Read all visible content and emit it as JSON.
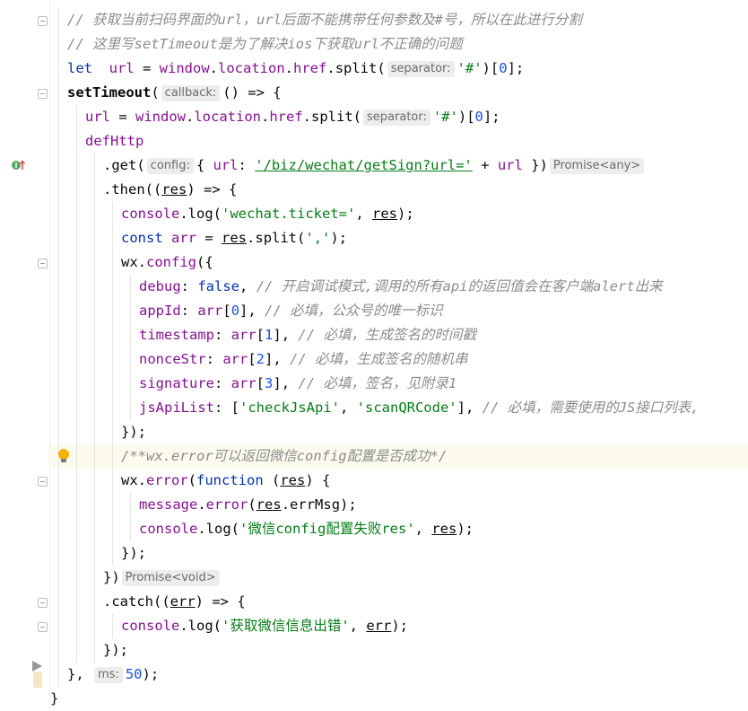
{
  "editor": {
    "lines": [
      {
        "segments": [
          [
            "cmt",
            "// 获取当前扫码界面的url，url后面不能携带任何参数及#号，所以在此进行分割"
          ]
        ]
      },
      {
        "segments": [
          [
            "cmt",
            "// 这里写setTimeout是为了解决ios下获取url不正确的问题"
          ]
        ]
      },
      {
        "segments": [
          [
            "kw",
            "let"
          ],
          [
            "",
            "  "
          ],
          [
            "prop",
            "url"
          ],
          [
            "",
            " = "
          ],
          [
            "prop",
            "window"
          ],
          [
            "",
            "."
          ],
          [
            "prop",
            "location"
          ],
          [
            "",
            "."
          ],
          [
            "prop",
            "href"
          ],
          [
            "",
            "."
          ],
          [
            "",
            "split("
          ],
          [
            "hint",
            "separator:"
          ],
          [
            "str",
            "'#'"
          ],
          [
            "",
            ")["
          ],
          [
            "num",
            "0"
          ],
          [
            "",
            "];"
          ]
        ]
      },
      {
        "segments": [
          [
            "bold",
            "setTimeout"
          ],
          [
            "",
            "("
          ],
          [
            "hint",
            "callback:"
          ],
          [
            "",
            "() => {"
          ]
        ]
      },
      {
        "segments": [
          [
            "prop",
            "url"
          ],
          [
            "",
            " = "
          ],
          [
            "prop",
            "window"
          ],
          [
            "",
            "."
          ],
          [
            "prop",
            "location"
          ],
          [
            "",
            "."
          ],
          [
            "prop",
            "href"
          ],
          [
            "",
            "."
          ],
          [
            "",
            "split("
          ],
          [
            "hint",
            "separator:"
          ],
          [
            "str",
            "'#'"
          ],
          [
            "",
            ")["
          ],
          [
            "num",
            "0"
          ],
          [
            "",
            "];"
          ]
        ]
      },
      {
        "segments": [
          [
            "prop",
            "defHttp"
          ]
        ]
      },
      {
        "segments": [
          [
            "",
            "."
          ],
          [
            "",
            "get("
          ],
          [
            "hint",
            "config:"
          ],
          [
            "",
            "{ "
          ],
          [
            "prop",
            "url"
          ],
          [
            "",
            ": "
          ],
          [
            "str u",
            "'/biz/wechat/getSign?url='"
          ],
          [
            "",
            " + "
          ],
          [
            "prop",
            "url"
          ],
          [
            "",
            " })"
          ],
          [
            "hint",
            "Promise<any>"
          ]
        ]
      },
      {
        "segments": [
          [
            "",
            "."
          ],
          [
            "",
            "then(("
          ],
          [
            "u",
            "res"
          ],
          [
            "",
            ") => {"
          ]
        ]
      },
      {
        "segments": [
          [
            "prop",
            "console"
          ],
          [
            "",
            "."
          ],
          [
            "",
            "log("
          ],
          [
            "str",
            "'wechat.ticket='"
          ],
          [
            "",
            ", "
          ],
          [
            "u",
            "res"
          ],
          [
            "",
            ");"
          ]
        ]
      },
      {
        "segments": [
          [
            "kw",
            "const"
          ],
          [
            "",
            " "
          ],
          [
            "prop",
            "arr"
          ],
          [
            "",
            " = "
          ],
          [
            "u",
            "res"
          ],
          [
            "",
            "."
          ],
          [
            "",
            "split("
          ],
          [
            "str",
            "','"
          ],
          [
            "",
            ");"
          ]
        ]
      },
      {
        "segments": [
          [
            "",
            "wx."
          ],
          [
            "prop",
            "config"
          ],
          [
            "",
            "({"
          ]
        ]
      },
      {
        "segments": [
          [
            "prop",
            "debug"
          ],
          [
            "",
            ": "
          ],
          [
            "kw",
            "false"
          ],
          [
            "",
            ", "
          ],
          [
            "cmt",
            "// 开启调试模式,调用的所有api的返回值会在客户端alert出来"
          ]
        ]
      },
      {
        "segments": [
          [
            "prop",
            "appId"
          ],
          [
            "",
            ": "
          ],
          [
            "prop",
            "arr"
          ],
          [
            "",
            "["
          ],
          [
            "num",
            "0"
          ],
          [
            "",
            "], "
          ],
          [
            "cmt",
            "// 必填，公众号的唯一标识"
          ]
        ]
      },
      {
        "segments": [
          [
            "prop",
            "timestamp"
          ],
          [
            "",
            ": "
          ],
          [
            "prop",
            "arr"
          ],
          [
            "",
            "["
          ],
          [
            "num",
            "1"
          ],
          [
            "",
            "], "
          ],
          [
            "cmt",
            "// 必填，生成签名的时间戳"
          ]
        ]
      },
      {
        "segments": [
          [
            "prop",
            "nonceStr"
          ],
          [
            "",
            ": "
          ],
          [
            "prop",
            "arr"
          ],
          [
            "",
            "["
          ],
          [
            "num",
            "2"
          ],
          [
            "",
            "], "
          ],
          [
            "cmt",
            "// 必填，生成签名的随机串"
          ]
        ]
      },
      {
        "segments": [
          [
            "prop",
            "signature"
          ],
          [
            "",
            ": "
          ],
          [
            "prop",
            "arr"
          ],
          [
            "",
            "["
          ],
          [
            "num",
            "3"
          ],
          [
            "",
            "], "
          ],
          [
            "cmt",
            "// 必填，签名，见附录1"
          ]
        ]
      },
      {
        "segments": [
          [
            "prop",
            "jsApiList"
          ],
          [
            "",
            ": ["
          ],
          [
            "str",
            "'checkJsApi'"
          ],
          [
            "",
            ", "
          ],
          [
            "str",
            "'scanQRCode'"
          ],
          [
            "",
            "], "
          ],
          [
            "cmt",
            "// 必填，需要使用的JS接口列表,"
          ]
        ]
      },
      {
        "segments": [
          [
            "",
            "});"
          ]
        ]
      },
      {
        "segments": [
          [
            "cmt",
            "/**wx.error可以返回微信config配置是否成功*/"
          ]
        ]
      },
      {
        "segments": [
          [
            "",
            "wx."
          ],
          [
            "prop",
            "error"
          ],
          [
            "",
            "("
          ],
          [
            "kw",
            "function"
          ],
          [
            "",
            " ("
          ],
          [
            "u",
            "res"
          ],
          [
            "",
            ") {"
          ]
        ]
      },
      {
        "segments": [
          [
            "prop",
            "message"
          ],
          [
            "",
            "."
          ],
          [
            "prop",
            "error"
          ],
          [
            "",
            "("
          ],
          [
            "u",
            "res"
          ],
          [
            "",
            "."
          ],
          [
            "",
            "errMsg);"
          ]
        ]
      },
      {
        "segments": [
          [
            "prop",
            "console"
          ],
          [
            "",
            "."
          ],
          [
            "",
            "log("
          ],
          [
            "str",
            "'微信config配置失败res'"
          ],
          [
            "",
            ", "
          ],
          [
            "u",
            "res"
          ],
          [
            "",
            ");"
          ]
        ]
      },
      {
        "segments": [
          [
            "",
            "});"
          ]
        ]
      },
      {
        "segments": [
          [
            "",
            "})"
          ],
          [
            "hint",
            "Promise<void>"
          ]
        ]
      },
      {
        "segments": [
          [
            "",
            "."
          ],
          [
            "",
            "catch(("
          ],
          [
            "u",
            "err"
          ],
          [
            "",
            ") => {"
          ]
        ]
      },
      {
        "segments": [
          [
            "prop",
            "console"
          ],
          [
            "",
            "."
          ],
          [
            "",
            "log("
          ],
          [
            "str",
            "'获取微信信息出错'"
          ],
          [
            "",
            ", "
          ],
          [
            "u",
            "err"
          ],
          [
            "",
            ");"
          ]
        ]
      },
      {
        "segments": [
          [
            "",
            "});"
          ]
        ]
      },
      {
        "segments": [
          [
            "",
            "}, "
          ],
          [
            "hint",
            "ms:"
          ],
          [
            "num",
            "50"
          ],
          [
            "",
            ");"
          ]
        ]
      },
      {
        "segments": [
          [
            "",
            "}"
          ]
        ]
      }
    ]
  },
  "gutter_icons": {
    "implements": "implementation-marker-icon",
    "intention": "lightbulb-icon",
    "bookmark": "bookmark-icon"
  },
  "colors": {
    "keyword": "#0033b3",
    "property": "#871094",
    "string": "#067d17",
    "number": "#1750eb",
    "comment": "#8c8c8c",
    "active_line": "#fcfaed"
  }
}
